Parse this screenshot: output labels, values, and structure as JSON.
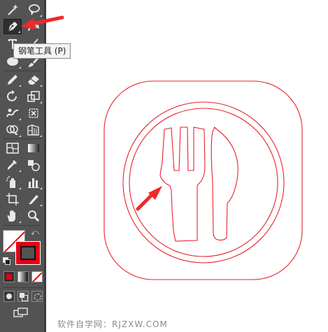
{
  "tooltip": {
    "text": "钢笔工具 (P)"
  },
  "toolbar": {
    "tools": [
      "magic-wand-icon",
      "lasso-icon",
      "pen-icon",
      "curvature-icon",
      "type-icon",
      "line-segment-icon",
      "ellipse-icon",
      "paintbrush-icon",
      "pencil-icon",
      "eraser-icon",
      "rotate-icon",
      "scale-icon",
      "warp-icon",
      "free-transform-icon",
      "shape-builder-icon",
      "perspective-grid-icon",
      "mesh-icon",
      "gradient-icon",
      "eyedropper-icon",
      "blend-icon",
      "symbol-sprayer-icon",
      "column-graph-icon",
      "artboard-icon",
      "slice-icon",
      "hand-icon",
      "zoom-icon"
    ],
    "fill_color": "#ffffff",
    "stroke_color": "#e60012"
  },
  "artwork": {
    "stroke_color": "#e8212b",
    "arrow_color": "#ee2a2a"
  },
  "watermark": {
    "text": "软件自学网：RJZXW.COM"
  }
}
